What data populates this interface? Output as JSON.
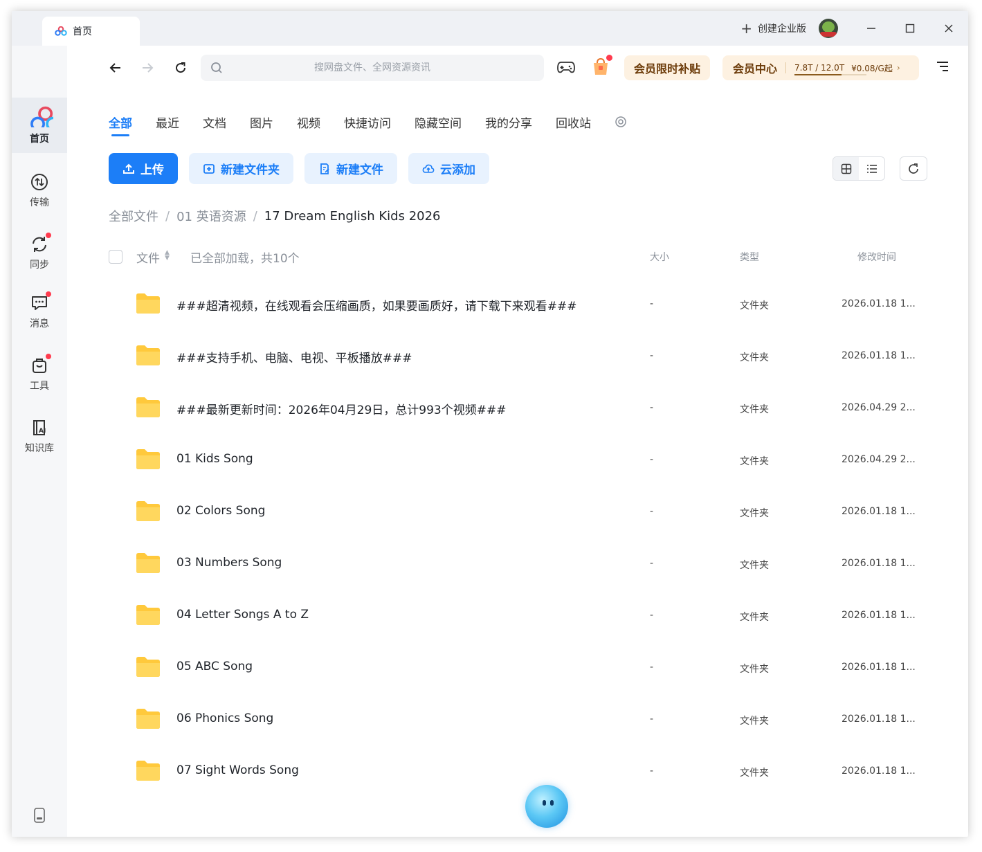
{
  "window": {
    "tab_title": "首页",
    "create_enterprise": "创建企业版"
  },
  "sidebar": {
    "items": [
      {
        "label": "首页",
        "icon": "home-cloud-icon",
        "active": true
      },
      {
        "label": "传输",
        "icon": "transfer-icon"
      },
      {
        "label": "同步",
        "icon": "sync-icon",
        "badge": true
      },
      {
        "label": "消息",
        "icon": "message-icon",
        "badge": true
      },
      {
        "label": "工具",
        "icon": "toolbox-icon",
        "badge": true
      },
      {
        "label": "知识库",
        "icon": "knowledge-base-icon"
      }
    ]
  },
  "toolbar": {
    "search_placeholder": "搜网盘文件、全网资源资讯",
    "promo_label": "会员限时补贴",
    "vip_label": "会员中心",
    "vip_quota": "7.8T / 12.0T",
    "vip_quota_fraction": 0.65,
    "vip_price": "¥0.08/G起",
    "vip_arrow": "›"
  },
  "tabs": [
    "全部",
    "最近",
    "文档",
    "图片",
    "视频",
    "快捷访问",
    "隐藏空间",
    "我的分享",
    "回收站"
  ],
  "actions": {
    "upload": "上传",
    "new_folder": "新建文件夹",
    "new_file": "新建文件",
    "cloud_add": "云添加"
  },
  "breadcrumb": {
    "items": [
      "全部文件",
      "01 英语资源",
      "17 Dream English Kids 2026"
    ],
    "separator": "/"
  },
  "list_header": {
    "name": "文件",
    "count": "已全部加载，共10个",
    "size": "大小",
    "type": "类型",
    "modified": "修改时间"
  },
  "files": [
    {
      "name": "###超清视频，在线观看会压缩画质，如果要画质好，请下载下来观看###",
      "size": "-",
      "type": "文件夹",
      "modified": "2026.01.18 1..."
    },
    {
      "name": "###支持手机、电脑、电视、平板播放###",
      "size": "-",
      "type": "文件夹",
      "modified": "2026.01.18 1..."
    },
    {
      "name": "###最新更新时间：2026年04月29日，总计993个视频###",
      "size": "-",
      "type": "文件夹",
      "modified": "2026.04.29 2..."
    },
    {
      "name": "01 Kids Song",
      "size": "-",
      "type": "文件夹",
      "modified": "2026.04.29 2..."
    },
    {
      "name": "02 Colors Song",
      "size": "-",
      "type": "文件夹",
      "modified": "2026.01.18 1..."
    },
    {
      "name": "03 Numbers Song",
      "size": "-",
      "type": "文件夹",
      "modified": "2026.01.18 1..."
    },
    {
      "name": "04 Letter Songs A to Z",
      "size": "-",
      "type": "文件夹",
      "modified": "2026.01.18 1..."
    },
    {
      "name": "05 ABC Song",
      "size": "-",
      "type": "文件夹",
      "modified": "2026.01.18 1..."
    },
    {
      "name": "06 Phonics Song",
      "size": "-",
      "type": "文件夹",
      "modified": "2026.01.18 1..."
    },
    {
      "name": "07 Sight Words Song",
      "size": "-",
      "type": "文件夹",
      "modified": "2026.01.18 1..."
    }
  ],
  "colors": {
    "accent": "#1c7ef7",
    "promo_bg": "#fdf1e1",
    "promo_text": "#6b3a08",
    "badge": "#ff3b4e",
    "folder": "#ffc93c"
  }
}
